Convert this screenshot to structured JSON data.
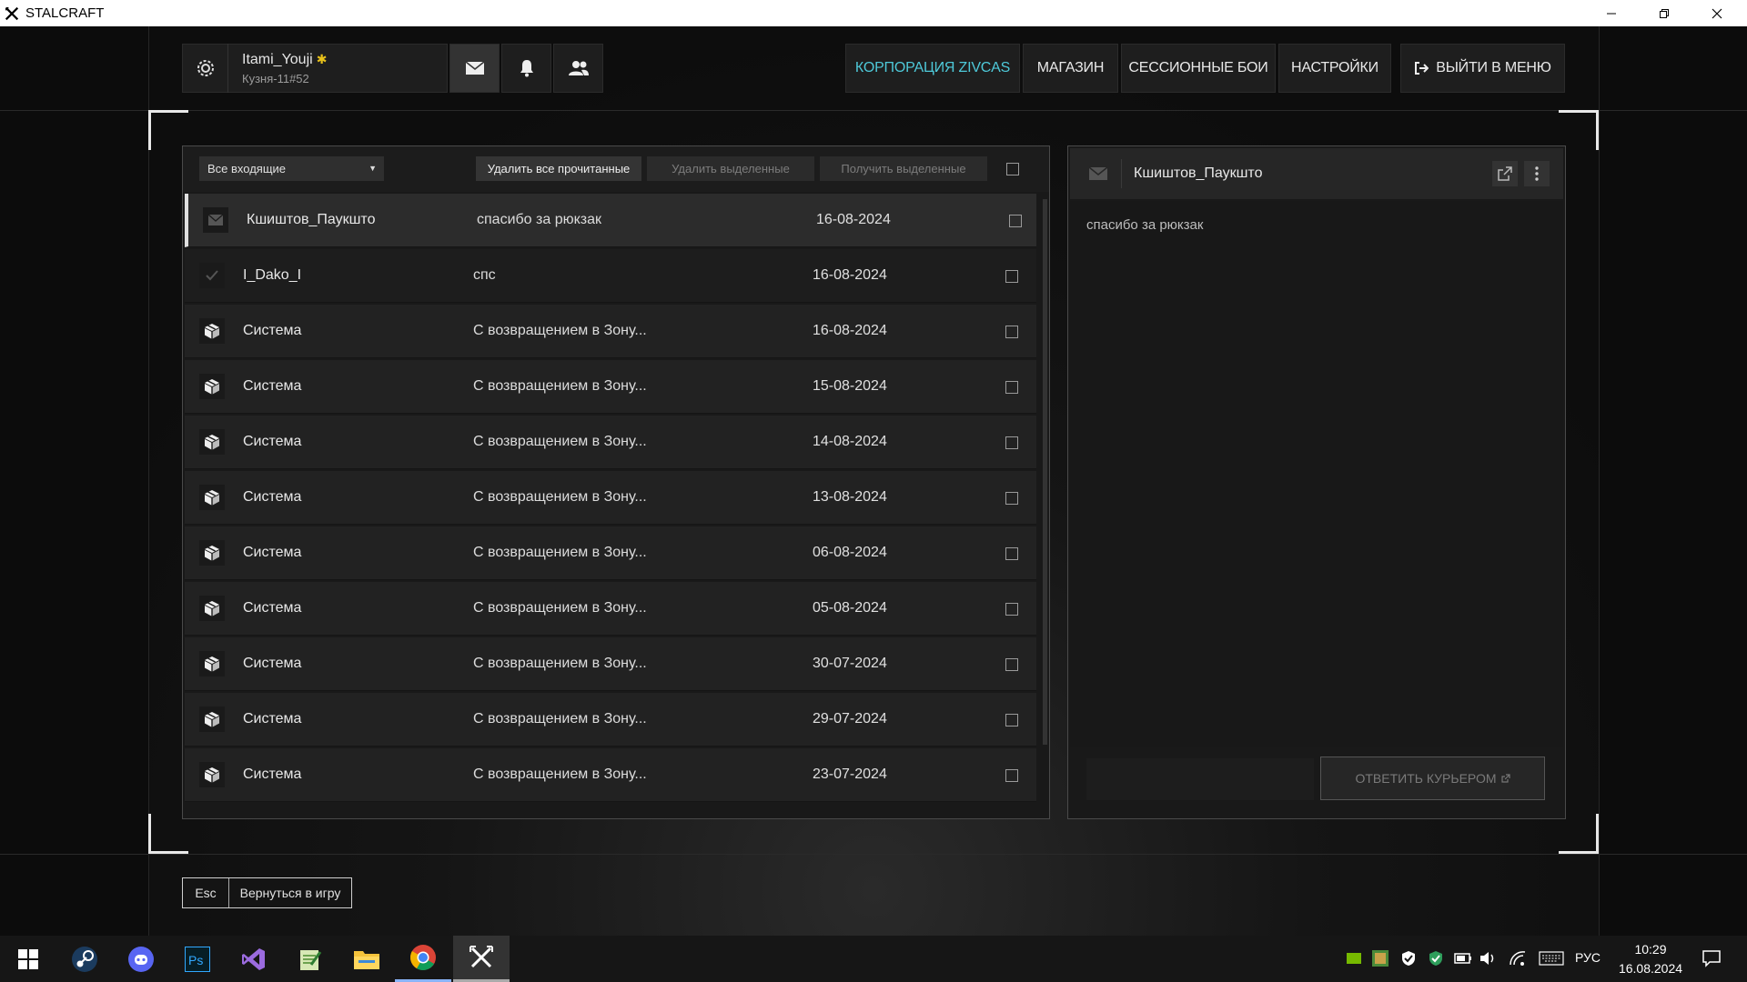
{
  "window": {
    "title": "STALCRAFT"
  },
  "profile": {
    "username": "Itami_Youji",
    "server": "Кузня-11#52",
    "star": "✱"
  },
  "nav": {
    "corporation": "КОРПОРАЦИЯ ZIVCAS",
    "shop": "МАГАЗИН",
    "session": "СЕССИОННЫЕ БОИ",
    "settings": "НАСТРОЙКИ",
    "exit": "ВЫЙТИ В МЕНЮ"
  },
  "colors": {
    "accent": "#4ec9d9",
    "star": "#e8c11a"
  },
  "mail": {
    "filter": "Все входящие",
    "delete_read": "Удалить все прочитанные",
    "delete_selected": "Удалить выделенные",
    "get_selected": "Получить выделенные",
    "messages": [
      {
        "icon": "envelope-icon",
        "sender": "Кшиштов_Паукшто",
        "subject": "спасибо за рюкзак",
        "date": "16-08-2024"
      },
      {
        "icon": "check-icon",
        "sender": "I_Dako_I",
        "subject": "спс",
        "date": "16-08-2024"
      },
      {
        "icon": "box-icon",
        "sender": "Система",
        "subject": "С возвращением в Зону...",
        "date": "16-08-2024"
      },
      {
        "icon": "box-icon",
        "sender": "Система",
        "subject": "С возвращением в Зону...",
        "date": "15-08-2024"
      },
      {
        "icon": "box-icon",
        "sender": "Система",
        "subject": "С возвращением в Зону...",
        "date": "14-08-2024"
      },
      {
        "icon": "box-icon",
        "sender": "Система",
        "subject": "С возвращением в Зону...",
        "date": "13-08-2024"
      },
      {
        "icon": "box-icon",
        "sender": "Система",
        "subject": "С возвращением в Зону...",
        "date": "06-08-2024"
      },
      {
        "icon": "box-icon",
        "sender": "Система",
        "subject": "С возвращением в Зону...",
        "date": "05-08-2024"
      },
      {
        "icon": "box-icon",
        "sender": "Система",
        "subject": "С возвращением в Зону...",
        "date": "30-07-2024"
      },
      {
        "icon": "box-icon",
        "sender": "Система",
        "subject": "С возвращением в Зону...",
        "date": "29-07-2024"
      },
      {
        "icon": "box-icon",
        "sender": "Система",
        "subject": "С возвращением в Зону...",
        "date": "23-07-2024"
      }
    ]
  },
  "reader": {
    "sender": "Кшиштов_Паукшто",
    "body": "спасибо за рюкзак",
    "reply": "ОТВЕТИТЬ КУРЬЕРОМ"
  },
  "footer": {
    "key": "Esc",
    "label": "Вернуться в игру"
  },
  "taskbar": {
    "lang": "РУС",
    "time": "10:29",
    "date": "16.08.2024"
  }
}
